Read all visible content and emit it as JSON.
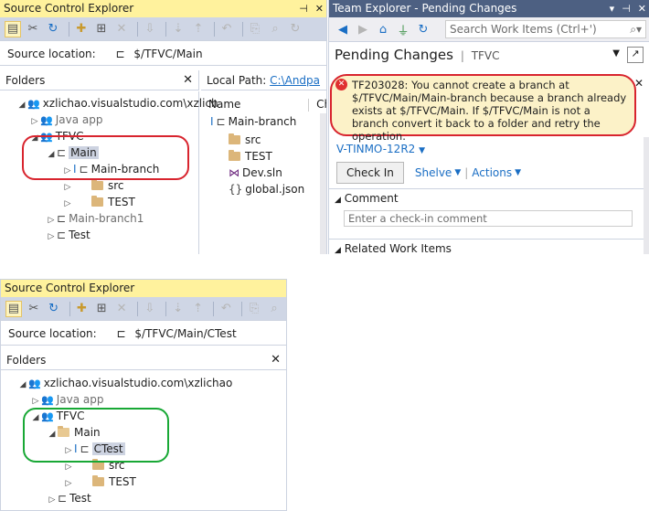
{
  "top_sce": {
    "title": "Source Control Explorer",
    "pin_icon": "pin-icon",
    "close_icon": "close-icon",
    "source_location_label": "Source location:",
    "source_location_value": "$/TFVC/Main",
    "folders_label": "Folders",
    "local_path_label": "Local Path:",
    "local_path_value": "C:\\Andpa",
    "col_name": "Name",
    "col_ch": "Ch",
    "tree": [
      {
        "label": "xzlichao.visualstudio.com\\xzlich"
      },
      {
        "label": "Java app"
      },
      {
        "label": "TFVC"
      },
      {
        "label": "Main"
      },
      {
        "label": "Main-branch"
      },
      {
        "label": "src"
      },
      {
        "label": "TEST"
      },
      {
        "label": "Main-branch1"
      },
      {
        "label": "Test"
      }
    ],
    "files": [
      {
        "label": "Main-branch"
      },
      {
        "label": "src"
      },
      {
        "label": "TEST"
      },
      {
        "label": "Dev.sln"
      },
      {
        "label": "global.json"
      }
    ]
  },
  "team_explorer": {
    "title": "Team Explorer - Pending Changes",
    "search_placeholder": "Search Work Items (Ctrl+')",
    "heading": "Pending Changes",
    "heading_sub": "TFVC",
    "error_text": "TF203028: You cannot create a branch at $/TFVC/Main/Main-branch because a branch already exists at $/TFVC/Main. If $/TFVC/Main is not a branch convert it back to a folder and retry the operation.",
    "workspace": "V-TINMO-12R2",
    "check_in_label": "Check In",
    "shelve_label": "Shelve",
    "actions_label": "Actions",
    "comment_label": "Comment",
    "comment_placeholder": "Enter a check-in comment",
    "related_label": "Related Work Items"
  },
  "bottom_sce": {
    "title": "Source Control Explorer",
    "source_location_label": "Source location:",
    "source_location_value": "$/TFVC/Main/CTest",
    "folders_label": "Folders",
    "tree": [
      {
        "label": "xzlichao.visualstudio.com\\xzlichao"
      },
      {
        "label": "Java app"
      },
      {
        "label": "TFVC"
      },
      {
        "label": "Main"
      },
      {
        "label": "CTest"
      },
      {
        "label": "src"
      },
      {
        "label": "TEST"
      },
      {
        "label": "Test"
      }
    ]
  },
  "colors": {
    "title_active": "#fff29d",
    "title_inactive": "#4d6082",
    "highlight_red": "#d8242e",
    "highlight_green": "#18a835",
    "link": "#1a6ec4"
  }
}
